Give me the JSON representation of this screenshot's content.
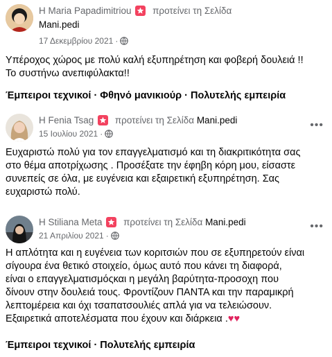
{
  "reviews": [
    {
      "reviewer": "Maria Papadimitriou",
      "prefix": "Η",
      "action": "προτείνει τη Σελίδα",
      "page": "Mani.pedi",
      "date": "17 Δεκεμβρίου 2021",
      "text": [
        "Υπέροχος χώρος με πολύ καλή εξυπηρέτηση και φοβερή δουλειά !!",
        "Το συστήνω ανεπιφύλακτα!!"
      ],
      "tags": "Έμπειροι τεχνικοί · Φθηνό μανικιούρ · Πολυτελής εμπειρία"
    },
    {
      "reviewer": "Fenia Tsag",
      "prefix": "Η",
      "action": "προτείνει τη Σελίδα",
      "page": "Mani.pedi",
      "date": "15 Ιουλίου 2021",
      "text": [
        "Ευχαριστώ πολύ για τον επαγγελματισμό και τη διακριτικότητα σας",
        "στο θέμα αποτρίχωσης . Προσέξατε την έφηβη κόρη μου, είσαστε",
        "συνεπείς σε όλα, με ευγένεια και εξαιρετική εξυπηρέτηση. Σας",
        "ευχαριστώ πολύ."
      ]
    },
    {
      "reviewer": "Stiliana Meta",
      "prefix": "Η",
      "action": "προτείνει τη Σελίδα",
      "page": "Mani.pedi",
      "date": "21 Απριλίου 2021",
      "text": [
        "Η απλότητα και η ευγένεια των κοριτσιών που σε εξυπηρετούν είναι",
        "σίγουρα ένα θετικό στοιχείο, όμως αυτό που κάνει τη διαφορά,",
        "είναι ο επαγγελματισμόςκαι η μεγάλη βαρύτητα-προσοχη  που",
        "δίνουν στην δουλειά τους. Φροντίζουν ΠΑΝΤΑ και την παραμικρή",
        "λεπτομέρεια και όχι τσαπατσουλιές απλά για να τελειώσουν.",
        "Εξαιρετικά αποτελέσματα που έχουν και διάρκεια ."
      ],
      "hearts": "♥♥",
      "tags": "Έμπειροι τεχνικοί · Πολυτελής εμπειρία"
    }
  ],
  "icons": {
    "recommend": "recommend-star-icon",
    "privacy": "globe-icon",
    "menu": "more-options-icon"
  },
  "colors": {
    "recommend_badge": "#f3425f",
    "secondary_text": "#65676b",
    "hearts": "#e0245e"
  }
}
